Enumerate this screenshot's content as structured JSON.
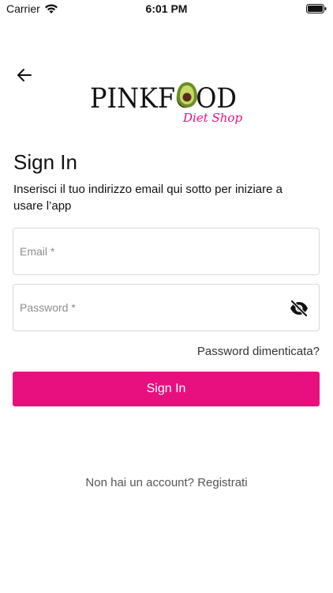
{
  "status_bar": {
    "carrier": "Carrier",
    "time": "6:01 PM",
    "wifi_icon": "wifi-icon",
    "battery_icon": "battery-icon"
  },
  "header": {
    "back_icon": "arrow-left-icon",
    "logo": {
      "brand": "PINKFOOD",
      "tagline": "Diet Shop"
    }
  },
  "main": {
    "title": "Sign In",
    "subtitle": "Inserisci il tuo indirizzo email qui sotto per iniziare a usare l’app",
    "email": {
      "placeholder": "Email *",
      "value": ""
    },
    "password": {
      "placeholder": "Password *",
      "value": "",
      "toggle_icon": "eye-off-icon"
    },
    "forgot_password": "Password dimenticata?",
    "signin_button": "Sign In",
    "footer": {
      "question": "Non hai un account?",
      "register": "Registrati"
    }
  },
  "colors": {
    "accent": "#e8107e",
    "avocado_green": "#6b8e23",
    "avocado_pit": "#5a2a1a"
  }
}
